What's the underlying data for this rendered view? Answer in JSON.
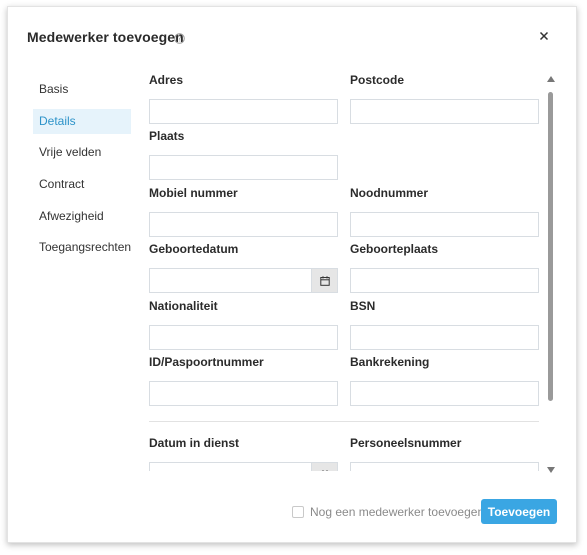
{
  "dialog": {
    "title": "Medewerker toevoegen",
    "help_icon": "question-circle-icon",
    "close_icon": "close-icon"
  },
  "nav": {
    "items": [
      {
        "label": "Basis",
        "active": false
      },
      {
        "label": "Details",
        "active": true
      },
      {
        "label": "Vrije velden",
        "active": false
      },
      {
        "label": "Contract",
        "active": false
      },
      {
        "label": "Afwezigheid",
        "active": false
      },
      {
        "label": "Toegangsrechten",
        "active": false
      }
    ]
  },
  "fields": {
    "adres": {
      "label": "Adres",
      "value": ""
    },
    "postcode": {
      "label": "Postcode",
      "value": ""
    },
    "plaats": {
      "label": "Plaats",
      "value": ""
    },
    "mobiel": {
      "label": "Mobiel nummer",
      "value": ""
    },
    "noodnummer": {
      "label": "Noodnummer",
      "value": ""
    },
    "geboortedatum": {
      "label": "Geboortedatum",
      "value": ""
    },
    "geboorteplaats": {
      "label": "Geboorteplaats",
      "value": ""
    },
    "nationaliteit": {
      "label": "Nationaliteit",
      "value": ""
    },
    "bsn": {
      "label": "BSN",
      "value": ""
    },
    "id_nummer": {
      "label": "ID/Paspoortnummer",
      "value": ""
    },
    "bankrekening": {
      "label": "Bankrekening",
      "value": ""
    },
    "datum_in_dienst": {
      "label": "Datum in dienst",
      "value": ""
    },
    "personeelsnummer": {
      "label": "Personeelsnummer",
      "value": ""
    }
  },
  "footer": {
    "checkbox_label": "Nog een medewerker toevoegen",
    "checkbox_checked": false,
    "submit_label": "Toevoegen"
  },
  "colors": {
    "accent": "#3aa6e3",
    "nav_active_bg": "#e6f3fb",
    "nav_active_text": "#2d93c9"
  }
}
